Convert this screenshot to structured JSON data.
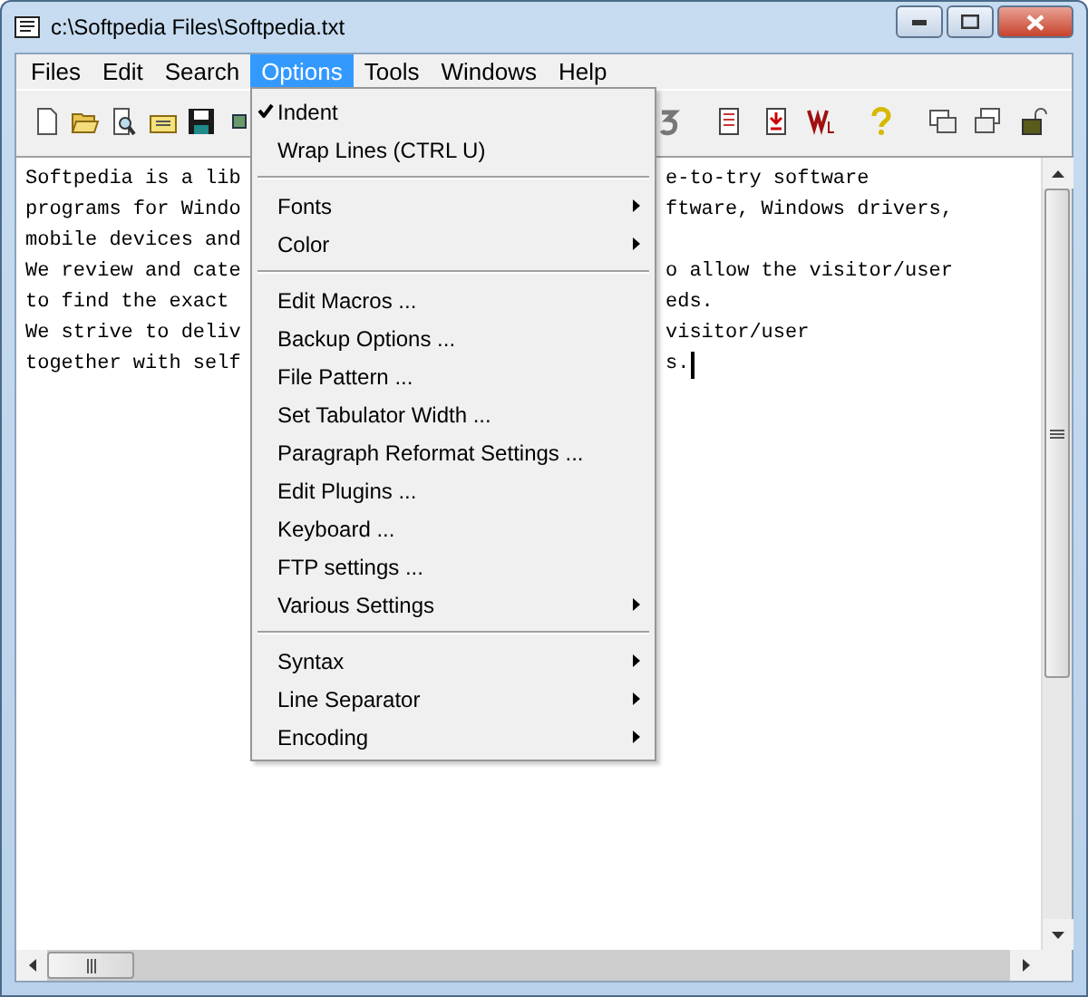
{
  "window": {
    "title": "c:\\Softpedia Files\\Softpedia.txt"
  },
  "menu_bar": [
    {
      "label": "Files",
      "selected": false
    },
    {
      "label": "Edit",
      "selected": false
    },
    {
      "label": "Search",
      "selected": false
    },
    {
      "label": "Options",
      "selected": true
    },
    {
      "label": "Tools",
      "selected": false
    },
    {
      "label": "Windows",
      "selected": false
    },
    {
      "label": "Help",
      "selected": false
    }
  ],
  "editor": {
    "lines": [
      {
        "left": "Softpedia is a lib",
        "right": "e-to-try software"
      },
      {
        "left": "programs for Windo",
        "right": "ftware, Windows drivers,"
      },
      {
        "left": "mobile devices and"
      },
      {
        "left": "We review and cate",
        "right": "o allow the visitor/user"
      },
      {
        "left": "to find the exact",
        "right": "eds."
      },
      {
        "left": "We strive to deliv",
        "right": "visitor/user"
      },
      {
        "left": "together with self",
        "right": "s.",
        "cursor": true
      }
    ]
  },
  "options_menu": {
    "groups": [
      [
        {
          "label": "Indent",
          "checked": true,
          "submenu": false
        },
        {
          "label": "Wrap Lines (CTRL U)",
          "checked": false,
          "submenu": false
        }
      ],
      [
        {
          "label": "Fonts",
          "checked": false,
          "submenu": true
        },
        {
          "label": "Color",
          "checked": false,
          "submenu": true
        }
      ],
      [
        {
          "label": "Edit Macros ...",
          "checked": false,
          "submenu": false
        },
        {
          "label": "Backup Options ...",
          "checked": false,
          "submenu": false
        },
        {
          "label": "File Pattern ...",
          "checked": false,
          "submenu": false
        },
        {
          "label": "Set Tabulator Width ...",
          "checked": false,
          "submenu": false
        },
        {
          "label": "Paragraph Reformat Settings ...",
          "checked": false,
          "submenu": false
        },
        {
          "label": "Edit Plugins ...",
          "checked": false,
          "submenu": false
        },
        {
          "label": "Keyboard ...",
          "checked": false,
          "submenu": false
        },
        {
          "label": "FTP settings ...",
          "checked": false,
          "submenu": false
        },
        {
          "label": "Various Settings",
          "checked": false,
          "submenu": true
        }
      ],
      [
        {
          "label": "Syntax",
          "checked": false,
          "submenu": true
        },
        {
          "label": "Line Separator",
          "checked": false,
          "submenu": true
        },
        {
          "label": "Encoding",
          "checked": false,
          "submenu": true
        }
      ]
    ]
  }
}
